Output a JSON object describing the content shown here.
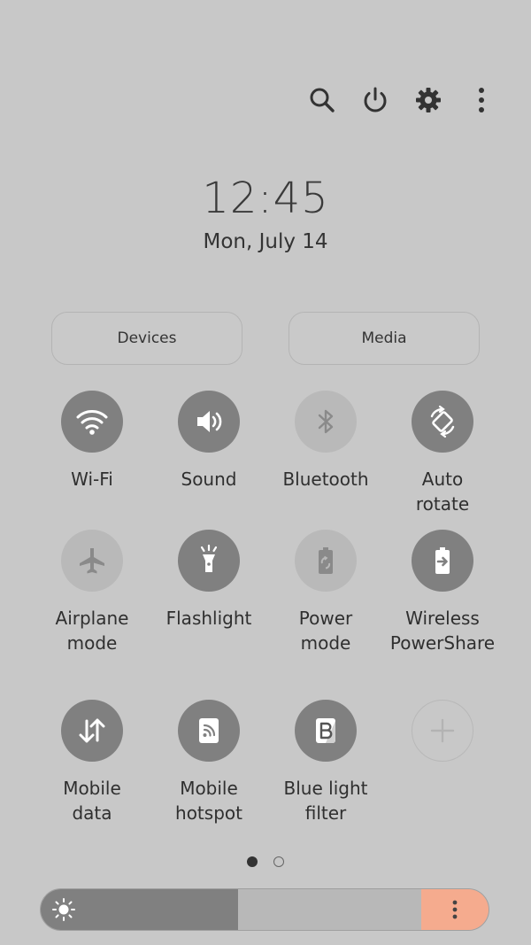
{
  "status": {
    "time": "12:45",
    "date": "Mon, July 14"
  },
  "header_icons": [
    "search-icon",
    "power-icon",
    "settings-icon",
    "more-vertical-icon"
  ],
  "panel_buttons": {
    "devices": "Devices",
    "media": "Media"
  },
  "tiles": [
    {
      "label": "Wi-Fi",
      "icon": "wifi-icon",
      "state": "on"
    },
    {
      "label": "Sound",
      "icon": "sound-icon",
      "state": "on"
    },
    {
      "label": "Bluetooth",
      "icon": "bluetooth-icon",
      "state": "off"
    },
    {
      "label": "Auto\nrotate",
      "icon": "auto-rotate-icon",
      "state": "on"
    },
    {
      "label": "Airplane\nmode",
      "icon": "airplane-icon",
      "state": "off"
    },
    {
      "label": "Flashlight",
      "icon": "flashlight-icon",
      "state": "on"
    },
    {
      "label": "Power\nmode",
      "icon": "power-mode-icon",
      "state": "off"
    },
    {
      "label": "Wireless\nPowerShare",
      "icon": "wireless-powershare-icon",
      "state": "on"
    },
    {
      "label": "Mobile\ndata",
      "icon": "mobile-data-icon",
      "state": "on"
    },
    {
      "label": "Mobile\nhotspot",
      "icon": "hotspot-icon",
      "state": "on"
    },
    {
      "label": "Blue light\nfilter",
      "icon": "blue-light-filter-icon",
      "state": "on"
    },
    {
      "label": "",
      "icon": "add-icon",
      "state": "add"
    }
  ],
  "pagination": {
    "pages": 2,
    "current": 1
  },
  "brightness": {
    "level": 0.44,
    "colors": {
      "fill": "#808080",
      "track": "#b8b8b8",
      "accent": "#f5ab8e"
    }
  }
}
